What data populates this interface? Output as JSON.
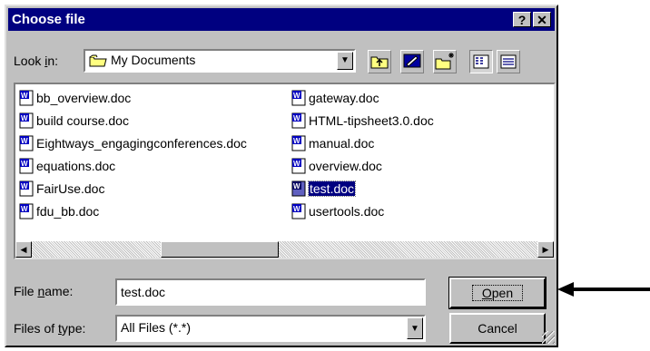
{
  "window": {
    "title": "Choose file",
    "help_glyph": "?",
    "close_glyph": "✕"
  },
  "lookin": {
    "label_pre": "Look ",
    "label_key": "i",
    "label_post": "n:",
    "value": "My Documents"
  },
  "toolbar": {
    "icons": [
      "up-folder-icon",
      "desktop-icon",
      "new-folder-icon",
      "list-view-icon",
      "details-view-icon"
    ]
  },
  "files": {
    "column1": [
      "bb_overview.doc",
      "build course.doc",
      "Eightways_engagingconferences.doc",
      "equations.doc",
      "FairUse.doc",
      "fdu_bb.doc"
    ],
    "column2": [
      "gateway.doc",
      "HTML-tipsheet3.0.doc",
      "manual.doc",
      "overview.doc",
      "test.doc",
      "usertools.doc"
    ],
    "selected": "test.doc"
  },
  "filename": {
    "label_pre": "File ",
    "label_key": "n",
    "label_post": "ame:",
    "value": "test.doc"
  },
  "filetype": {
    "label_pre": "Files of ",
    "label_key": "t",
    "label_post": "ype:",
    "value": "All Files (*.*)"
  },
  "buttons": {
    "open_key": "O",
    "open_rest": "pen",
    "cancel": "Cancel"
  },
  "colors": {
    "titlebar": "#000080",
    "face": "#c0c0c0",
    "selection": "#000080"
  }
}
